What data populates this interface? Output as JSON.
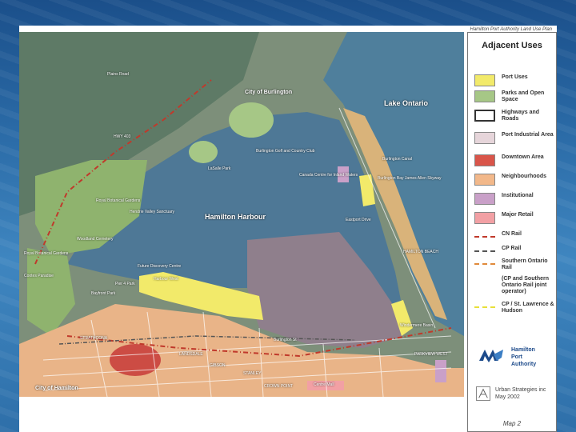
{
  "header": {
    "caption": "Hamilton Port Authority Land Use Plan"
  },
  "map": {
    "places": {
      "city_burlington": "City of Burlington",
      "lake_ontario": "Lake Ontario",
      "hamilton_harbour": "Hamilton Harbour",
      "burlington_golf": "Burlington Golf and Country Club",
      "lasalle_park": "LaSalle Park",
      "royal_botanical": "Royal Botanical Gardens",
      "hendrie_valley": "Hendrie Valley Sanctuary",
      "woodland_cemetery": "Woodland Cemetery",
      "royal_botanical_2": "Royal Botanical Gardens",
      "cootes_paradise": "Cootes Paradise",
      "bayfront_park": "Bayfront Park",
      "pier4_park": "Pier 4 Park",
      "discovery_centre": "Future Discovery Centre",
      "harbour_west": "Harbour West",
      "canada_centre": "Canada Centre for Inland Waters",
      "burlington_canal": "Burlington Canal",
      "burlington_skyway": "Burlington Bay James Allen Skyway",
      "eastport_drive": "Eastport Drive",
      "hamilton_beach": "HAMILTON BEACH",
      "windermere_basin": "Windermere Basin",
      "strathcona": "STRATHCONA",
      "landsdale": "LANDSDALE",
      "gibson": "GIBSON",
      "stanley": "STANLEY",
      "crown_point": "CROWN POINT",
      "centre_mall": "Centre Mall",
      "parkview_west": "PARKVIEW WEST",
      "city_hamilton": "City of Hamilton",
      "hwy403": "HWY 403",
      "plains_rd": "Plains Road",
      "burlington_st": "Burlington St"
    }
  },
  "legend": {
    "title": "Adjacent Uses",
    "items": [
      {
        "label": "Port Uses",
        "color": "#f2ea6a"
      },
      {
        "label": "Parks and Open Space",
        "color": "#a6c786"
      },
      {
        "label": "Highways and Roads",
        "color": "#ffffff"
      },
      {
        "label": "Port Industrial Area",
        "color": "#e6d5da"
      },
      {
        "label": "Downtown Area",
        "color": "#d9554a"
      },
      {
        "label": "Neighbourhoods",
        "color": "#f2b88a"
      },
      {
        "label": "Institutional",
        "color": "#c9a0c8"
      },
      {
        "label": "Major Retail",
        "color": "#f2a0a4"
      }
    ],
    "lines": [
      {
        "label": "CN Rail",
        "color": "#c0392b"
      },
      {
        "label": "CP Rail",
        "color": "#555555"
      },
      {
        "label": "Southern Ontario Rail",
        "color": "#e08a3a"
      },
      {
        "label": "CP / St. Lawrence & Hudson",
        "color": "#e8e03a"
      }
    ],
    "note": "(CP and Southern Ontario Rail joint operator)",
    "authority": [
      "Hamilton",
      "Port",
      "Authority"
    ],
    "consultant": [
      "Urban Strategies inc",
      "May 2002"
    ],
    "map_number": "Map 2"
  }
}
